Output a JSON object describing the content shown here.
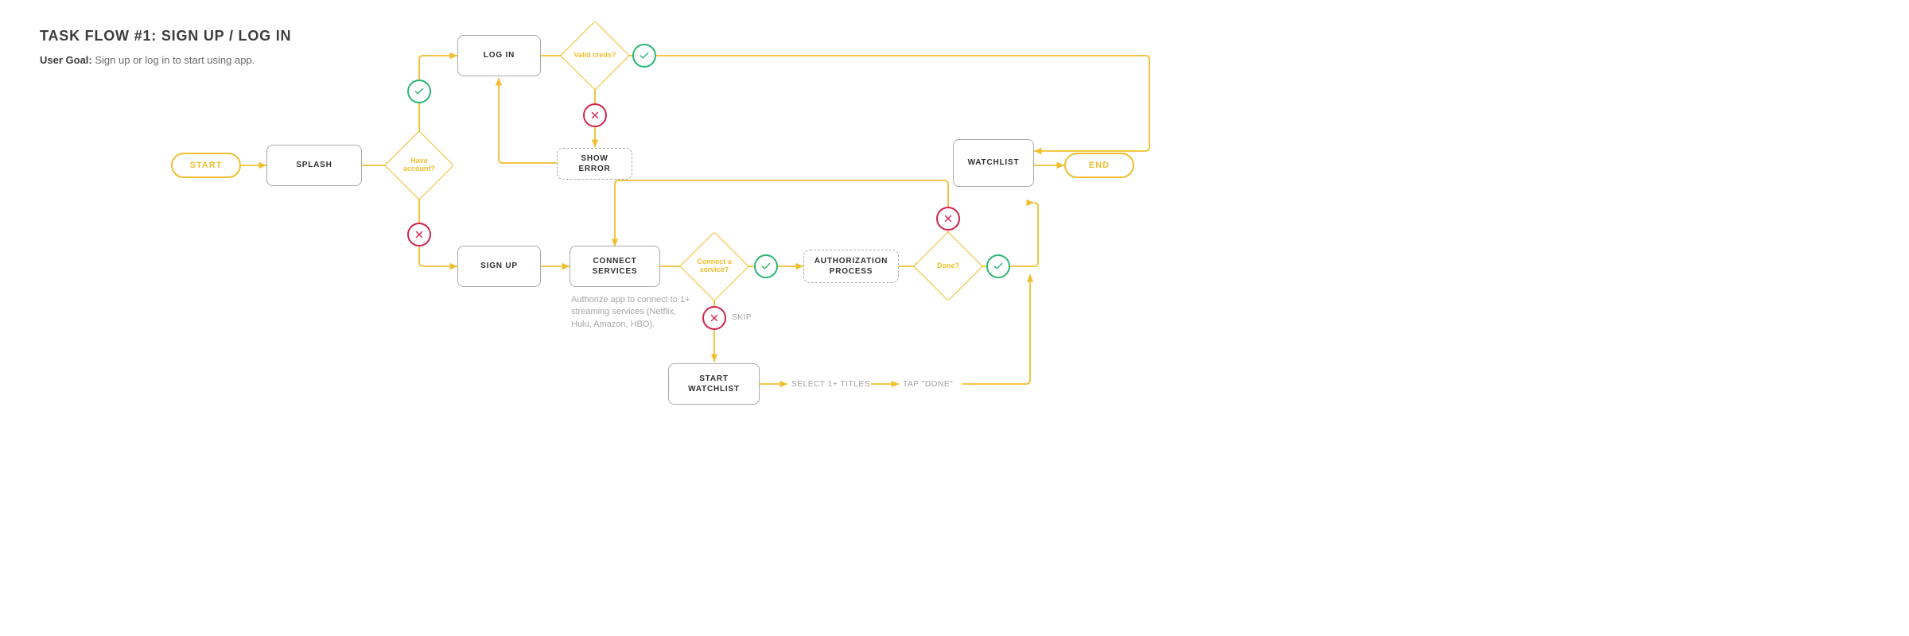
{
  "header": {
    "title": "TASK FLOW #1: SIGN UP / LOG IN",
    "goal_label": "User Goal:",
    "goal_text": "Sign up or log in to start using app."
  },
  "nodes": {
    "start": "START",
    "end": "END",
    "splash": "SPLASH",
    "login": "LOG IN",
    "signup": "SIGN UP",
    "connect": "CONNECT SERVICES",
    "show_error": "SHOW ERROR",
    "auth": "AUTHORIZATION PROCESS",
    "start_watchlist": "START WATCHLIST",
    "watchlist": "WATCHLIST"
  },
  "decisions": {
    "have_account": "Have account?",
    "valid_creds": "Valid creds?",
    "connect_service": "Connect a service?",
    "done": "Done?"
  },
  "annotations": {
    "connect_note": "Authorize app to connect to 1+ streaming services (Netflix, Hulu, Amazon, HBO).",
    "skip": "SKIP",
    "select_titles": "SELECT 1+ TITLES",
    "tap_done": "TAP \"DONE\""
  },
  "colors": {
    "flow": "#efbf2f",
    "yes": "#2bb673",
    "no": "#d0234b",
    "box": "#a9a9a9"
  }
}
